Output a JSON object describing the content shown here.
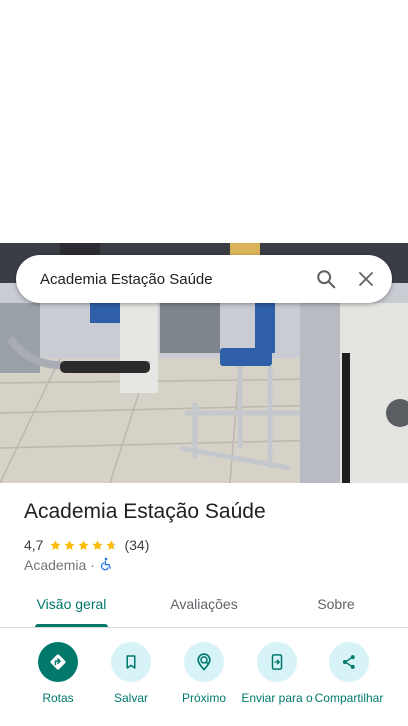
{
  "search": {
    "value": "Academia Estação Saúde"
  },
  "place": {
    "title": "Academia Estação Saúde",
    "rating": "4,7",
    "stars": 4.7,
    "reviews": "(34)",
    "category": "Academia",
    "separator": "·"
  },
  "tabs": [
    {
      "label": "Visão geral",
      "active": true
    },
    {
      "label": "Avaliações",
      "active": false
    },
    {
      "label": "Sobre",
      "active": false
    }
  ],
  "actions": [
    {
      "label": "Rotas",
      "icon": "directions-icon"
    },
    {
      "label": "Salvar",
      "icon": "bookmark-icon"
    },
    {
      "label": "Próximo",
      "icon": "nearby-icon"
    },
    {
      "label": "Enviar para o",
      "icon": "send-to-phone-icon"
    },
    {
      "label": "Compartilhar",
      "icon": "share-icon"
    }
  ],
  "colors": {
    "accent": "#00796b",
    "action_bg": "#d7f3f8",
    "star": "#fbbc04",
    "accessibility": "#1a73e8"
  }
}
